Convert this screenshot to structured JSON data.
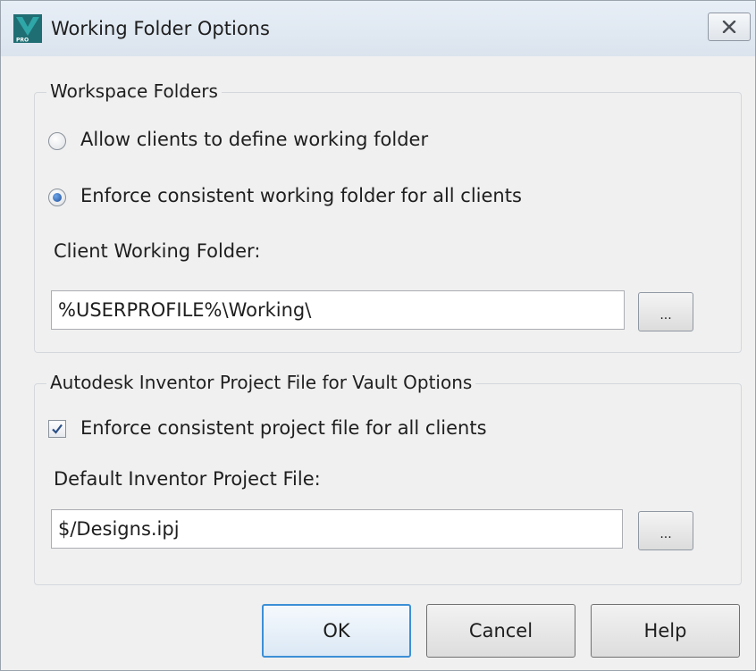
{
  "window": {
    "title": "Working Folder Options",
    "icon": "autodesk-vault-app-icon",
    "close_icon": "close-icon"
  },
  "workspace": {
    "legend": "Workspace Folders",
    "option_allow": {
      "label": "Allow clients to define working folder",
      "selected": false
    },
    "option_enforce": {
      "label": "Enforce consistent working folder for all clients",
      "selected": true
    },
    "folder_label": "Client Working Folder:",
    "folder_value": "%USERPROFILE%\\Working\\",
    "browse_label": "..."
  },
  "inventor": {
    "legend": "Autodesk Inventor Project File for Vault Options",
    "enforce_checkbox": {
      "label": "Enforce consistent project file for all clients",
      "checked": true
    },
    "project_label": "Default Inventor Project File:",
    "project_value": "$/Designs.ipj",
    "browse_label": "..."
  },
  "buttons": {
    "ok": "OK",
    "cancel": "Cancel",
    "help": "Help"
  },
  "colors": {
    "default_button_border": "#3c8fd6",
    "radio_selected": "#1f4f9c",
    "checkmark": "#2a4f86"
  }
}
